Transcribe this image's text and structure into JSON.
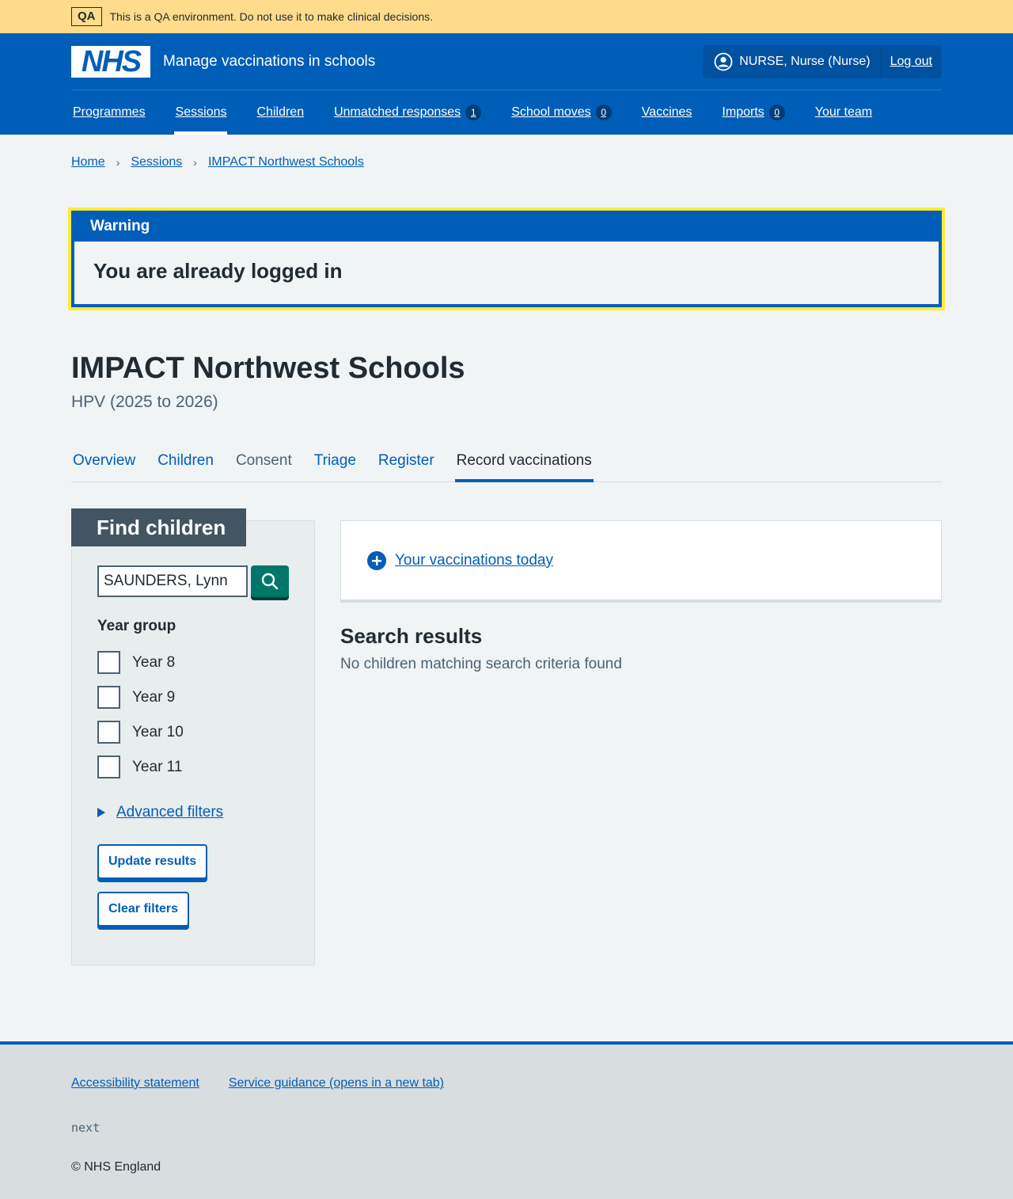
{
  "qa_banner": {
    "tag": "QA",
    "message": "This is a QA environment. Do not use it to make clinical decisions."
  },
  "header": {
    "logo": "NHS",
    "service_name": "Manage vaccinations in schools",
    "user": "NURSE, Nurse (Nurse)",
    "logout": "Log out"
  },
  "nav": {
    "programmes": "Programmes",
    "sessions": "Sessions",
    "children": "Children",
    "unmatched": "Unmatched responses",
    "unmatched_count": "1",
    "school_moves": "School moves",
    "school_moves_count": "0",
    "vaccines": "Vaccines",
    "imports": "Imports",
    "imports_count": "0",
    "your_team": "Your team"
  },
  "breadcrumb": {
    "home": "Home",
    "sessions": "Sessions",
    "current": "IMPACT Northwest Schools"
  },
  "warning": {
    "label": "Warning",
    "text": "You are already logged in"
  },
  "page": {
    "title": "IMPACT Northwest Schools",
    "caption": "HPV (2025 to 2026)"
  },
  "tabs": {
    "overview": "Overview",
    "children": "Children",
    "consent": "Consent",
    "triage": "Triage",
    "register": "Register",
    "record": "Record vaccinations"
  },
  "filter": {
    "heading": "Find children",
    "search_value": "SAUNDERS, Lynn",
    "year_group_label": "Year group",
    "years": [
      "Year 8",
      "Year 9",
      "Year 10",
      "Year 11"
    ],
    "advanced": "Advanced filters",
    "update": "Update results",
    "clear": "Clear filters"
  },
  "main": {
    "vaccinations_today": "Your vaccinations today",
    "results_heading": "Search results",
    "results_text": "No children matching search criteria found"
  },
  "footer": {
    "accessibility": "Accessibility statement",
    "guidance": "Service guidance (opens in a new tab)",
    "env": "next",
    "copyright": "© NHS England"
  },
  "colors": {
    "brand_blue": "#005eb8",
    "qa_yellow": "#ffdb8b",
    "warning_yellow": "#ffeb3b",
    "search_green": "#00766b"
  }
}
